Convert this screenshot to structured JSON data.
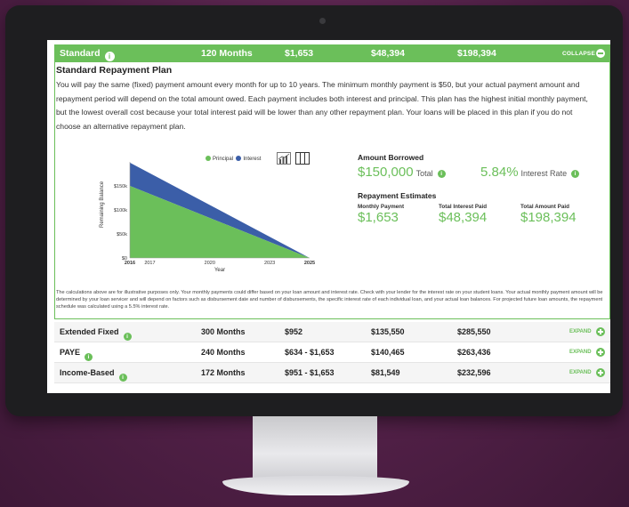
{
  "standard": {
    "name": "Standard",
    "months": "120 Months",
    "monthly": "$1,653",
    "interest": "$48,394",
    "total": "$198,394",
    "collapse_label": "COLLAPSE"
  },
  "panel": {
    "title": "Standard Repayment Plan",
    "description": "You will pay the same (fixed) payment amount every month for up to 10 years. The minimum monthly payment is $50, but your actual payment amount and repayment period will depend on the total amount owed. Each payment includes both interest and principal. This plan has the highest initial monthly payment, but the lowest overall cost because your total interest paid will be lower than any other repayment plan. Your loans will be placed in this plan if you do not choose an alternative repayment plan."
  },
  "chart_data": {
    "type": "area",
    "stacked": true,
    "x": [
      2016,
      2025
    ],
    "x_ticks": [
      "2016",
      "2017",
      "2020",
      "2023",
      "2025"
    ],
    "x_tick_values": [
      2016,
      2017,
      2020,
      2023,
      2025
    ],
    "x_bold_ticks": [
      "2016",
      "2025"
    ],
    "y_ticks": [
      "$0",
      "$50k",
      "$100k",
      "$150k"
    ],
    "y_tick_values": [
      0,
      50000,
      100000,
      150000
    ],
    "ylim": [
      0,
      200000
    ],
    "xlabel": "Year",
    "ylabel": "Remaining Balance",
    "series": [
      {
        "name": "Principal",
        "color": "#6bbf5a",
        "values": [
          150000,
          0
        ]
      },
      {
        "name": "Interest",
        "color": "#3b5ea8",
        "values": [
          48394,
          0
        ]
      }
    ],
    "legend_position": "top-right",
    "grid": false
  },
  "summary": {
    "amount_borrowed_label": "Amount Borrowed",
    "amount": "$150,000",
    "total_label": "Total",
    "rate": "5.84%",
    "rate_label": "Interest Rate",
    "estimates_label": "Repayment Estimates",
    "monthly_label": "Monthly Payment",
    "monthly_value": "$1,653",
    "interest_label": "Total Interest Paid",
    "interest_value": "$48,394",
    "total_paid_label": "Total Amount Paid",
    "total_paid_value": "$198,394"
  },
  "disclaimer": "The calculations above are for illustrative purposes only. Your monthly payments could differ based on your loan amount and interest rate. Check with your lender for the interest rate on your student loans. Your actual monthly payment amount will be determined by your loan servicer and will depend on factors such as disbursement date and number of disbursements, the specific interest rate of each individual loan, and your actual loan balances. For projected future loan amounts, the repayment schedule was calculated using a 5.5% interest rate.",
  "rows": [
    {
      "name": "Extended Fixed",
      "months": "300 Months",
      "monthly": "$952",
      "interest": "$135,550",
      "total": "$285,550",
      "action": "EXPAND"
    },
    {
      "name": "PAYE",
      "months": "240 Months",
      "monthly": "$634 - $1,653",
      "interest": "$140,465",
      "total": "$263,436",
      "action": "EXPAND"
    },
    {
      "name": "Income-Based",
      "months": "172 Months",
      "monthly": "$951 - $1,653",
      "interest": "$81,549",
      "total": "$232,596",
      "action": "EXPAND"
    }
  ],
  "colors": {
    "brand_green": "#6bbf5a",
    "interest_blue": "#3b5ea8"
  }
}
